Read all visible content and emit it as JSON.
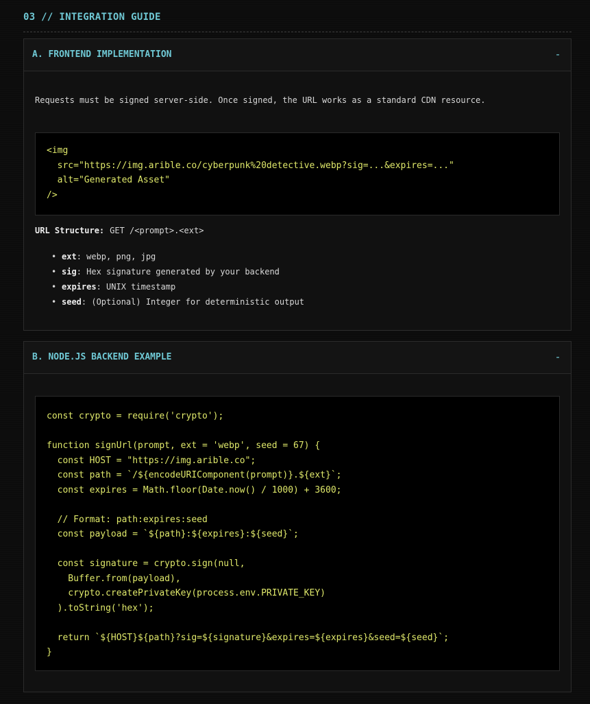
{
  "section": {
    "title": "03 // INTEGRATION GUIDE"
  },
  "panels": {
    "frontend": {
      "title": "A. FRONTEND IMPLEMENTATION",
      "toggle": "-",
      "intro": "Requests must be signed server-side. Once signed, the URL works as a standard CDN resource.",
      "code": "<img\n  src=\"https://img.arible.co/cyberpunk%20detective.webp?sig=...&expires=...\"\n  alt=\"Generated Asset\"\n/>",
      "url_structure_label": "URL Structure:",
      "url_structure_value": "GET /<prompt>.<ext>",
      "bullets": [
        {
          "key": "ext",
          "text": ": webp, png, jpg"
        },
        {
          "key": "sig",
          "text": ": Hex signature generated by your backend"
        },
        {
          "key": "expires",
          "text": ": UNIX timestamp"
        },
        {
          "key": "seed",
          "text": ": (Optional) Integer for deterministic output"
        }
      ]
    },
    "backend": {
      "title": "B. NODE.JS BACKEND EXAMPLE",
      "toggle": "-",
      "code": "const crypto = require('crypto');\n\nfunction signUrl(prompt, ext = 'webp', seed = 67) {\n  const HOST = \"https://img.arible.co\";\n  const path = `/${encodeURIComponent(prompt)}.${ext}`;\n  const expires = Math.floor(Date.now() / 1000) + 3600;\n\n  // Format: path:expires:seed\n  const payload = `${path}:${expires}:${seed}`;\n\n  const signature = crypto.sign(null,\n    Buffer.from(payload),\n    crypto.createPrivateKey(process.env.PRIVATE_KEY)\n  ).toString('hex');\n\n  return `${HOST}${path}?sig=${signature}&expires=${expires}&seed=${seed}`;\n}"
    }
  },
  "colors": {
    "accent": "#6fc8d4",
    "code_text": "#dfe86a",
    "background": "#0c0c0c",
    "panel_bg": "#111111"
  }
}
